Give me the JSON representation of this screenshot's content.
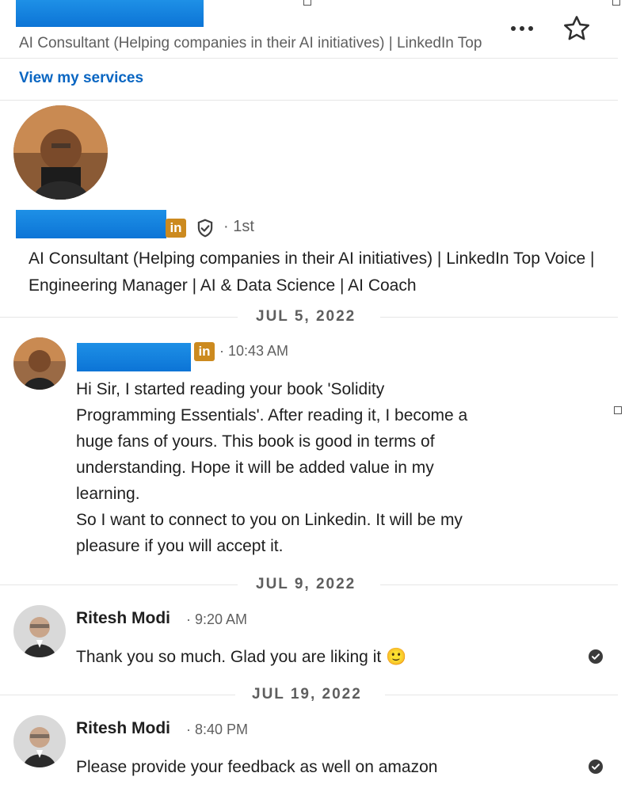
{
  "header": {
    "subtitle": "AI Consultant (Helping companies in their AI initiatives) | LinkedIn Top Voice | Engineering Manager | AI & Data Science | AI Coach",
    "more_icon": "more-horizontal-icon",
    "star_icon": "star-outline-icon"
  },
  "services": {
    "label": "View my services"
  },
  "profile": {
    "linkedin_badge": "in",
    "degree": "· 1st",
    "headline": "AI Consultant (Helping companies in their AI initiatives) | LinkedIn Top Voice | Engineering Manager | AI & Data Science | AI Coach"
  },
  "thread": [
    {
      "date": "JUL 5, 2022",
      "sender": "",
      "badge": "in",
      "time": "· 10:43 AM",
      "lines": [
        "Hi Sir, I started reading your book 'Solidity",
        "Programming Essentials'. After reading it, I become a",
        "huge fans of yours. This book is good in terms of",
        "understanding. Hope it will be added value in my",
        "learning.",
        "So I want to connect to you on Linkedin. It will be my",
        "pleasure if you will accept it."
      ]
    },
    {
      "date": "JUL 9, 2022",
      "sender": "Ritesh Modi",
      "time": "· 9:20 AM",
      "text": "Thank you so much. Glad you are liking it 🙂"
    },
    {
      "date": "JUL 19, 2022",
      "sender": "Ritesh Modi",
      "time": "· 8:40 PM",
      "text": "Please provide your feedback as well on amazon"
    }
  ],
  "colors": {
    "link": "#0a66c2",
    "redaction": "#1e90e6",
    "badge": "#cc8a1f"
  }
}
